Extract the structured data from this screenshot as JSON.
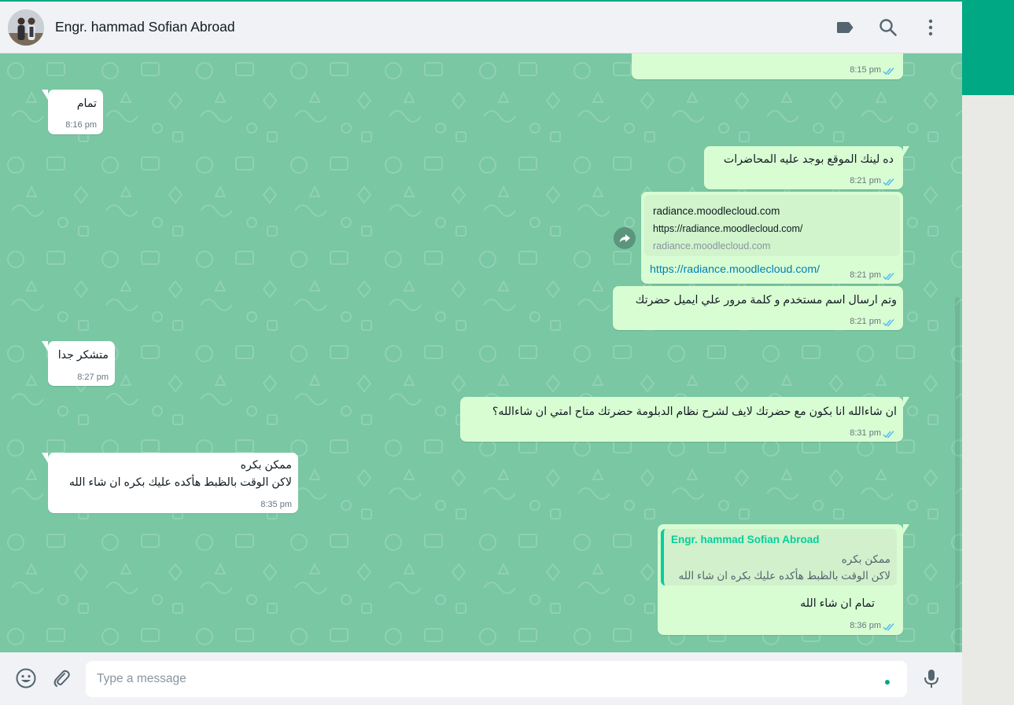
{
  "header": {
    "contact_name": "Engr. hammad Sofian Abroad",
    "icons": [
      "label-icon",
      "search-icon",
      "menu-icon"
    ]
  },
  "messages": [
    {
      "id": "m0",
      "dir": "out",
      "text": "",
      "time": "8:15 pm",
      "status": "read"
    },
    {
      "id": "m1",
      "dir": "in",
      "text": "تمام",
      "time": "8:16 pm"
    },
    {
      "id": "m2",
      "dir": "out",
      "text": "ده لينك الموقع بوجد عليه المحاضرات",
      "time": "8:21 pm",
      "status": "read"
    },
    {
      "id": "m3",
      "dir": "out",
      "type": "link",
      "preview_title": "radiance.moodlecloud.com",
      "preview_desc": "https://radiance.moodlecloud.com/",
      "preview_domain": "radiance.moodlecloud.com",
      "link": "https://radiance.moodlecloud.com/",
      "time": "8:21 pm",
      "status": "read"
    },
    {
      "id": "m4",
      "dir": "out",
      "text": "وتم ارسال اسم مستخدم و كلمة مرور علي ايميل حضرتك",
      "time": "8:21 pm",
      "status": "read"
    },
    {
      "id": "m5",
      "dir": "in",
      "text": "متشكر جدا",
      "time": "8:27 pm"
    },
    {
      "id": "m6",
      "dir": "out",
      "text": "ان شاءالله انا بكون مع حضرتك لايف لشرح نظام الدبلومة حضرتك متاح امتي ان شاءالله؟",
      "time": "8:31 pm",
      "status": "read"
    },
    {
      "id": "m7",
      "dir": "in",
      "lines": [
        "ممكن بكره",
        "لاكن الوقت بالظبط هأكده عليك بكره ان شاء الله"
      ],
      "time": "8:35 pm"
    },
    {
      "id": "m8",
      "dir": "out",
      "type": "reply",
      "quote_name": "Engr. hammad Sofian Abroad",
      "quote_lines": [
        "ممكن بكره",
        "لاكن الوقت بالظبط هأكده عليك بكره ان شاء الله"
      ],
      "text": "تمام ان شاء الله",
      "time": "8:36 pm",
      "status": "read"
    }
  ],
  "footer": {
    "placeholder": "Type a message",
    "value": ""
  },
  "colors": {
    "accent": "#00a884",
    "chat_bg": "#79c7a3",
    "bubble_out": "#d9fdd3",
    "bubble_in": "#ffffff",
    "read_tick": "#53bdeb",
    "link": "#027eb5"
  }
}
